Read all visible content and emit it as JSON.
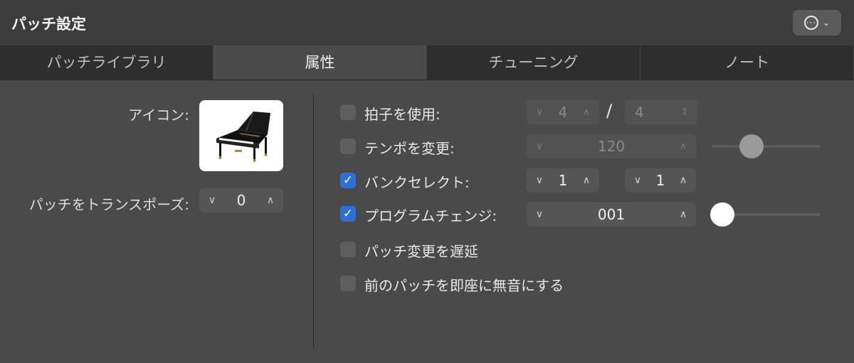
{
  "window": {
    "title": "パッチ設定"
  },
  "tabs": [
    {
      "label": "パッチライブラリ",
      "active": false
    },
    {
      "label": "属性",
      "active": true
    },
    {
      "label": "チューニング",
      "active": false
    },
    {
      "label": "ノート",
      "active": false
    }
  ],
  "left": {
    "icon_label": "アイコン:",
    "transpose_label": "パッチをトランスポーズ:",
    "transpose_value": "0"
  },
  "options": {
    "time_signature": {
      "label": "拍子を使用:",
      "checked": false,
      "numerator": "4",
      "denominator": "4",
      "separator": "/"
    },
    "tempo": {
      "label": "テンポを変更:",
      "checked": false,
      "value": "120",
      "slider_level": 0.35
    },
    "bank_select": {
      "label": "バンクセレクト:",
      "checked": true,
      "value1": "1",
      "value2": "1"
    },
    "program_change": {
      "label": "プログラムチェンジ:",
      "checked": true,
      "value": "001",
      "slider_level": 0.0
    },
    "delay_patch": {
      "label": "パッチ変更を遅延",
      "checked": false
    },
    "mute_previous": {
      "label": "前のパッチを即座に無音にする",
      "checked": false
    }
  },
  "colors": {
    "accent": "#2d6fd6",
    "background": "#4a4a4a"
  }
}
